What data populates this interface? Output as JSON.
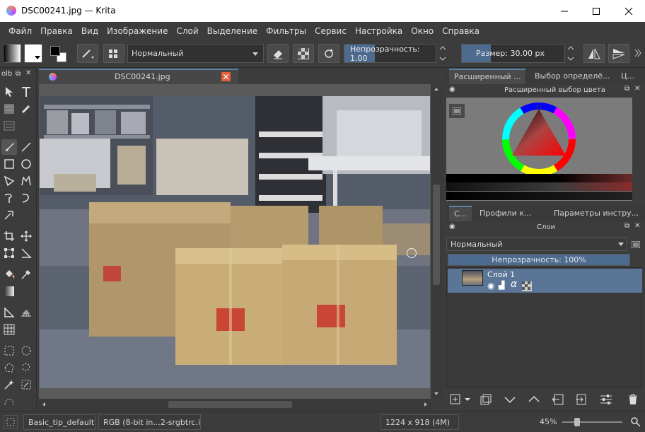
{
  "window": {
    "title": "DSC00241.jpg — Krita"
  },
  "menu": [
    "Файл",
    "Правка",
    "Вид",
    "Изображение",
    "Слой",
    "Выделение",
    "Фильтры",
    "Сервис",
    "Настройка",
    "Окно",
    "Справка"
  ],
  "toolbar": {
    "blend_mode": "Нормальный",
    "opacity_label": "Непрозрачность:",
    "opacity_value": "1.00",
    "opacity_fraction": 0.33,
    "size_label": "Размер:",
    "size_value": "30.00 px",
    "size_fraction": 0.28
  },
  "toolbox": {
    "title": "olb"
  },
  "document": {
    "tab_title": "DSC00241.jpg",
    "vscroll_fraction": 0.6,
    "hscroll_fraction": 0.33
  },
  "color_docker": {
    "tabs": [
      "Расширенный ...",
      "Выбор определё...",
      "Ц..."
    ],
    "title": "Расширенный выбор цвета"
  },
  "layers_docker": {
    "tabs": [
      "С...",
      "Профили к...",
      "Параметры инстру..."
    ],
    "title": "Слои",
    "blend_mode": "Нормальный",
    "opacity_label": "Непрозрачность:",
    "opacity_value": "100%",
    "layers": [
      {
        "name": "Слой 1"
      }
    ]
  },
  "statusbar": {
    "brush": "Basic_tip_default",
    "color_profile": "RGB (8-bit in...2-srgbtrc.icc",
    "dimensions": "1224 x 918 (4M)",
    "zoom": "45%",
    "zoom_fraction": 0.1
  },
  "colors": {
    "accent": "#4d6a8f",
    "tab_accent": "#5d7fa8",
    "background": "#3c3c3c",
    "close_tab": "#e35d3b"
  }
}
